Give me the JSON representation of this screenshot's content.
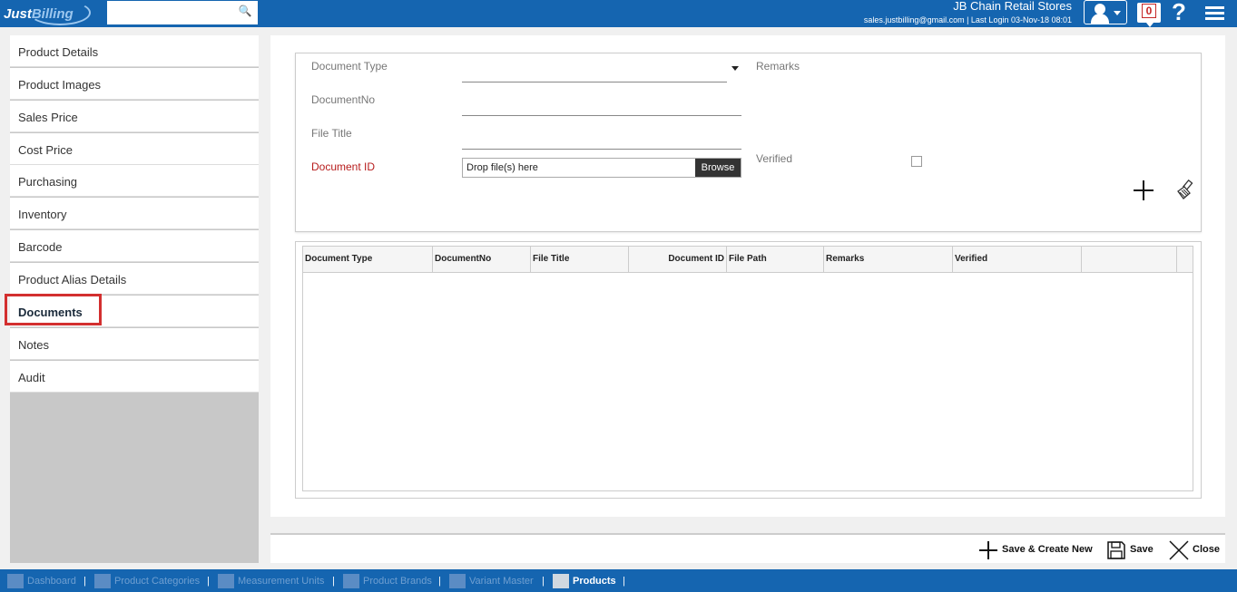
{
  "header": {
    "logo_a": "Just",
    "logo_b": "Billing",
    "search_placeholder": "",
    "store_name": "JB Chain Retail Stores",
    "login_info": "sales.justbilling@gmail.com | Last Login 03-Nov-18 08:01",
    "notification_count": "0",
    "help_symbol": "?"
  },
  "sidebar": {
    "items": [
      {
        "label": "Product Details"
      },
      {
        "label": "Product Images"
      },
      {
        "label": "Sales Price"
      },
      {
        "label": "Cost Price"
      },
      {
        "label": "Purchasing"
      },
      {
        "label": "Inventory"
      },
      {
        "label": "Barcode"
      },
      {
        "label": "Product Alias Details"
      },
      {
        "label": "Documents"
      },
      {
        "label": "Notes"
      },
      {
        "label": "Audit"
      }
    ],
    "active_index": 8
  },
  "form": {
    "document_type_label": "Document Type",
    "document_no_label": "DocumentNo",
    "file_title_label": "File Title",
    "document_id_label": "Document ID",
    "remarks_label": "Remarks",
    "verified_label": "Verified",
    "file_drop_placeholder": "Drop file(s) here",
    "browse_label": "Browse"
  },
  "grid": {
    "columns": [
      "Document Type",
      "DocumentNo",
      "File Title",
      "Document ID",
      "File Path",
      "Remarks",
      "Verified",
      ""
    ]
  },
  "actions": {
    "save_create_new": "Save & Create New",
    "save": "Save",
    "close": "Close"
  },
  "bottom_nav": {
    "items": [
      {
        "label": "Dashboard"
      },
      {
        "label": "Product Categories"
      },
      {
        "label": "Measurement Units"
      },
      {
        "label": "Product Brands"
      },
      {
        "label": "Variant Master"
      },
      {
        "label": "Products"
      }
    ],
    "separator": "|"
  }
}
